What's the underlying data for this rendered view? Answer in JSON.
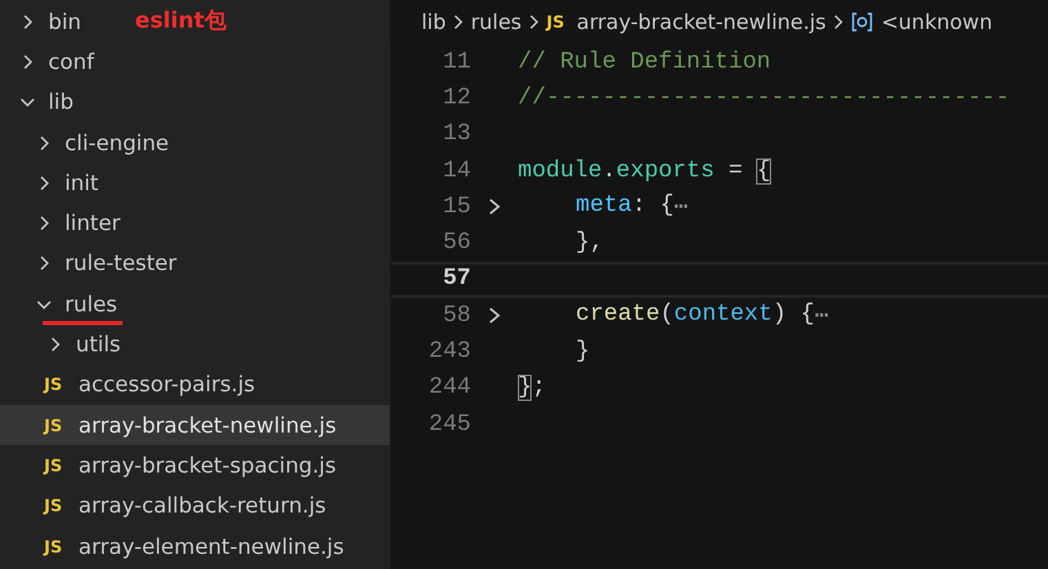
{
  "annotation": {
    "text": "eslint包"
  },
  "explorer": {
    "items": [
      {
        "kind": "folder",
        "name": "bin",
        "expanded": false,
        "selected": false,
        "underlined": false
      },
      {
        "kind": "folder",
        "name": "conf",
        "expanded": false,
        "selected": false,
        "underlined": false
      },
      {
        "kind": "folder",
        "name": "lib",
        "expanded": true,
        "selected": false,
        "underlined": false,
        "children": [
          {
            "kind": "folder",
            "name": "cli-engine",
            "expanded": false,
            "selected": false,
            "underlined": false
          },
          {
            "kind": "folder",
            "name": "init",
            "expanded": false,
            "selected": false,
            "underlined": false
          },
          {
            "kind": "folder",
            "name": "linter",
            "expanded": false,
            "selected": false,
            "underlined": false
          },
          {
            "kind": "folder",
            "name": "rule-tester",
            "expanded": false,
            "selected": false,
            "underlined": false
          },
          {
            "kind": "folder",
            "name": "rules",
            "expanded": true,
            "selected": false,
            "underlined": true,
            "children": [
              {
                "kind": "folder",
                "name": "utils",
                "expanded": false,
                "selected": false,
                "underlined": false
              },
              {
                "kind": "file",
                "icon_text": "JS",
                "name": "accessor-pairs.js",
                "selected": false,
                "underlined": false
              },
              {
                "kind": "file",
                "icon_text": "JS",
                "name": "array-bracket-newline.js",
                "selected": true,
                "underlined": false
              },
              {
                "kind": "file",
                "icon_text": "JS",
                "name": "array-bracket-spacing.js",
                "selected": false,
                "underlined": false
              },
              {
                "kind": "file",
                "icon_text": "JS",
                "name": "array-callback-return.js",
                "selected": false,
                "underlined": false
              },
              {
                "kind": "file",
                "icon_text": "JS",
                "name": "array-element-newline.js",
                "selected": false,
                "underlined": false
              }
            ]
          }
        ]
      }
    ]
  },
  "breadcrumb": [
    {
      "kind": "folder",
      "text": "lib"
    },
    {
      "kind": "folder",
      "text": "rules"
    },
    {
      "kind": "file",
      "icon_text": "JS",
      "text": "array-bracket-newline.js"
    },
    {
      "kind": "symbol",
      "text": "<unknown"
    }
  ],
  "editor": {
    "lines": [
      {
        "number": "11",
        "folded": false,
        "current": false,
        "indented": false,
        "tokens": [
          {
            "kind": "comment",
            "text": "// Rule Definition"
          }
        ]
      },
      {
        "number": "12",
        "folded": false,
        "current": false,
        "indented": false,
        "tokens": [
          {
            "kind": "comment",
            "text": "//---------------------------------"
          }
        ]
      },
      {
        "number": "13",
        "folded": false,
        "current": false
      },
      {
        "number": "14",
        "folded": false,
        "current": false,
        "indented": false,
        "tokens": [
          {
            "kind": "variable",
            "text": "module"
          },
          {
            "kind": "plain",
            "text": "."
          },
          {
            "kind": "variable",
            "text": "exports"
          },
          {
            "kind": "plain",
            "text": " = "
          },
          {
            "kind": "bracket-match",
            "text": "{"
          }
        ]
      },
      {
        "number": "15",
        "folded": true,
        "current": false,
        "indented": true,
        "tokens": [
          {
            "kind": "property",
            "text": "meta"
          },
          {
            "kind": "plain",
            "text": ": {"
          },
          {
            "kind": "ellipsis",
            "text": "⋯"
          }
        ]
      },
      {
        "number": "56",
        "folded": false,
        "current": false,
        "indented": true,
        "tokens": [
          {
            "kind": "plain",
            "text": "},"
          }
        ]
      },
      {
        "number": "57",
        "folded": false,
        "current": true
      },
      {
        "number": "58",
        "folded": true,
        "current": false,
        "indented": true,
        "tokens": [
          {
            "kind": "function",
            "text": "create"
          },
          {
            "kind": "plain",
            "text": "("
          },
          {
            "kind": "parameter",
            "text": "context"
          },
          {
            "kind": "plain",
            "text": ") {"
          },
          {
            "kind": "ellipsis",
            "text": "⋯"
          }
        ]
      },
      {
        "number": "243",
        "folded": false,
        "current": false,
        "indented": true,
        "tokens": [
          {
            "kind": "plain",
            "text": "}"
          }
        ]
      },
      {
        "number": "244",
        "folded": false,
        "current": false,
        "indented": false,
        "tokens": [
          {
            "kind": "bracket-match",
            "text": "}"
          },
          {
            "kind": "plain",
            "text": ";"
          }
        ]
      },
      {
        "number": "245",
        "folded": false,
        "current": false
      }
    ]
  }
}
